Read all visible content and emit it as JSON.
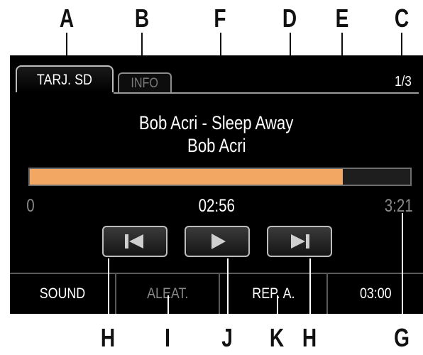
{
  "callouts": {
    "top": [
      "A",
      "B",
      "F",
      "D",
      "E",
      "C"
    ],
    "bottom": [
      "H",
      "I",
      "J",
      "K",
      "H",
      "G"
    ]
  },
  "tabs": {
    "active_label": "TARJ. SD",
    "inactive_label": "INFO"
  },
  "page_indicator": "1/3",
  "track": {
    "title": "Bob Acri - Sleep Away",
    "artist": "Bob Acri"
  },
  "progress": {
    "start_label": "0",
    "elapsed": "02:56",
    "total": "3:21",
    "fraction": 0.822
  },
  "controls": {
    "previous_icon": "skip-previous-icon",
    "play_icon": "play-icon",
    "next_icon": "skip-next-icon"
  },
  "bottom_bar": {
    "sound": "SOUND",
    "shuffle": "ALEAT.",
    "repeat": "REP. A.",
    "time": "03:00"
  },
  "colors": {
    "progress_fill": "#f2a862",
    "screen_background": "#000000",
    "inactive_text": "#8a8a8a"
  }
}
